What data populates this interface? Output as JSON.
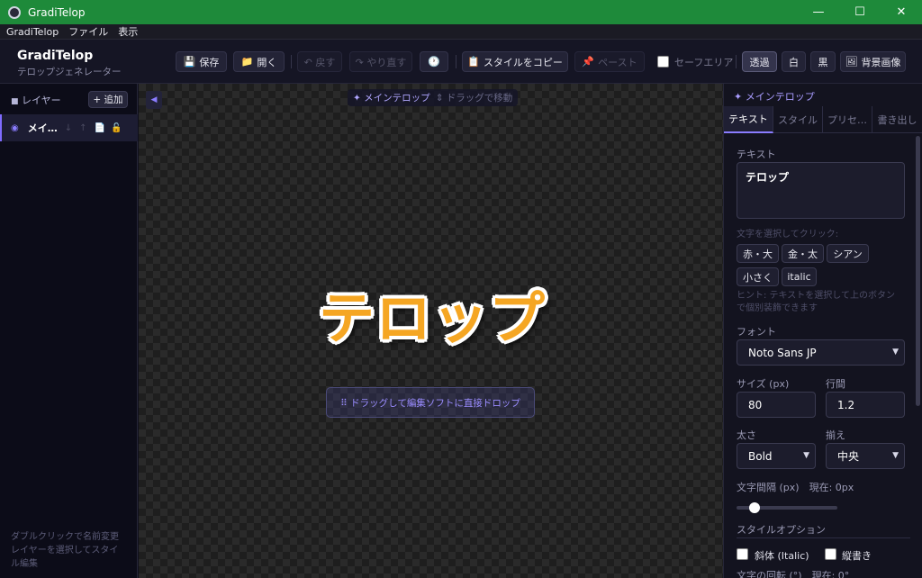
{
  "window": {
    "title": "GradiTelop",
    "minimize": "—",
    "maximize": "☐",
    "close": "✕"
  },
  "menu": [
    "GradiTelop",
    "ファイル",
    "表示"
  ],
  "brand": {
    "name": "GradiTelop",
    "subtitle": "テロップジェネレーター"
  },
  "toolbar": {
    "save": "保存",
    "open": "開く",
    "undo": "↶ 戻す",
    "redo": "↷ やり直す",
    "history_icon": "clock-icon",
    "copy_style": "スタイルをコピー",
    "paste": "ペースト",
    "safe_area": "セーフエリア",
    "bg_transparent": "透過",
    "bg_white": "白",
    "bg_black": "黒",
    "bg_image": "背景画像"
  },
  "layers": {
    "title": "レイヤー",
    "add": "+ 追加",
    "items": [
      {
        "name": "メイ…",
        "visible": true,
        "locked": true
      }
    ],
    "hint_line1": "ダブルクリックで名前変更",
    "hint_line2": "レイヤーを選択してスタイ",
    "hint_line3": "ル編集"
  },
  "canvas": {
    "layer_tag": "✦ メインテロップ",
    "drag_hint": "⇕ ドラッグで移動",
    "telop_text": "テロップ",
    "drop_button": "⠿ ドラッグして編集ソフトに直接ドロップ"
  },
  "panel": {
    "title": "✦ メインテロップ",
    "tabs": [
      "テキスト",
      "スタイル",
      "プリセ…",
      "書き出し"
    ],
    "active_tab": 0,
    "text_label": "テキスト",
    "text_value": "テロップ",
    "select_hint": "文字を選択してクリック:",
    "chips": [
      "赤・大",
      "金・太",
      "シアン",
      "小さく",
      "italic"
    ],
    "hint_line1": "ヒント: テキストを選択して上のボタン",
    "hint_line2": "で個別装飾できます",
    "font_label": "フォント",
    "font_value": "Noto Sans JP",
    "size_label": "サイズ (px)",
    "size_value": "80",
    "line_height_label": "行間",
    "line_height_value": "1.2",
    "weight_label": "太さ",
    "weight_value": "Bold",
    "align_label": "揃え",
    "align_value": "中央",
    "spacing_label": "文字間隔 (px)　現在: 0px",
    "spacing_value": 0,
    "style_options_label": "スタイルオプション",
    "italic_label": "斜体 (Italic)",
    "vertical_label": "縦書き",
    "rotation_label": "文字の回転 (°)　現在: 0°"
  }
}
